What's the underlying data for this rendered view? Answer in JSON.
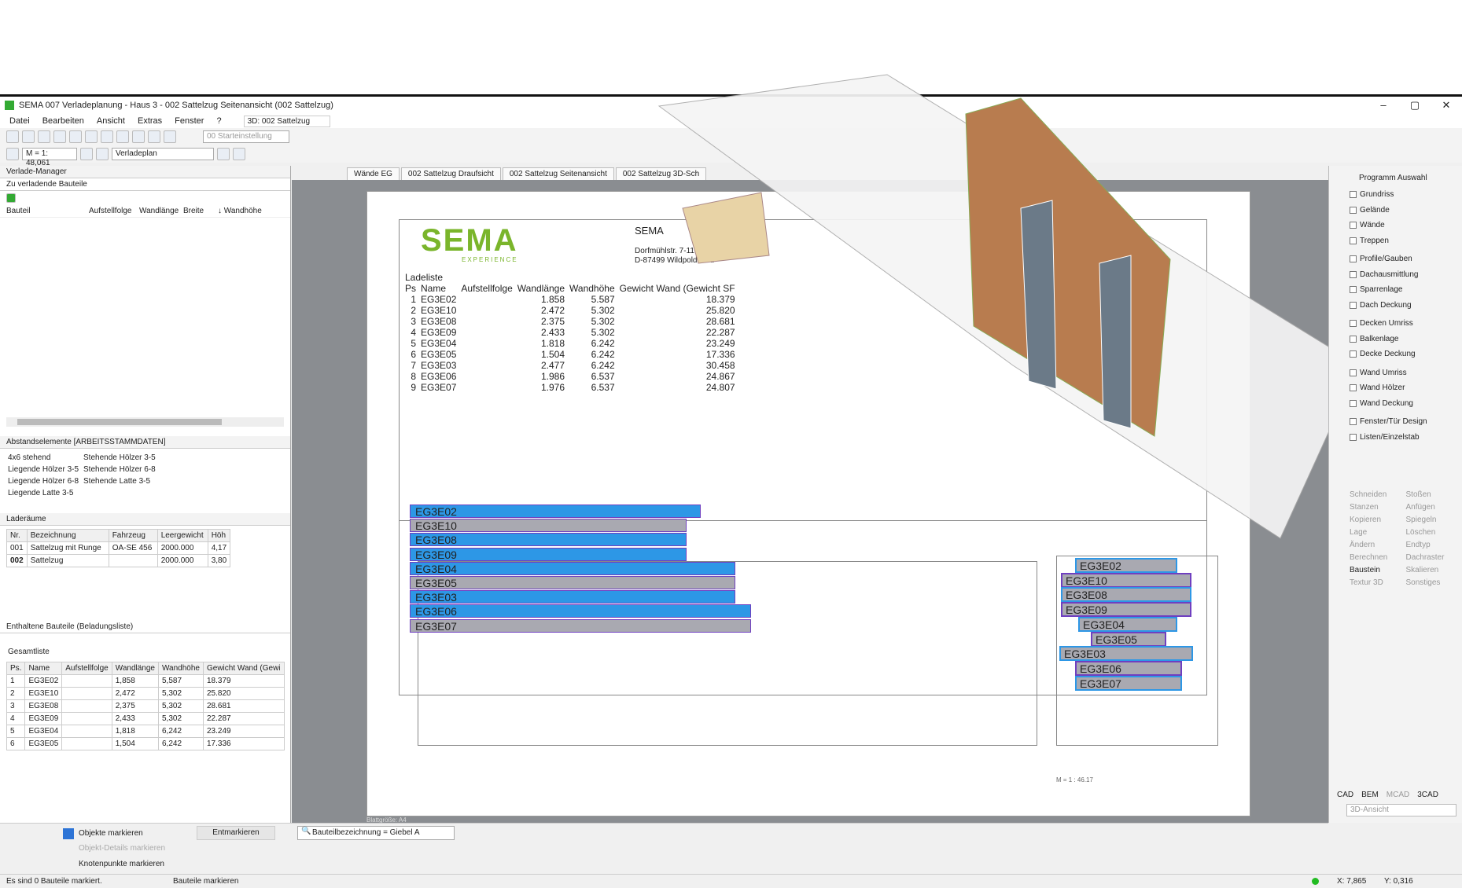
{
  "window": {
    "title": "SEMA  007 Verladeplanung - Haus 3  - 002 Sattelzug Seitenansicht (002 Sattelzug)",
    "min": "–",
    "max": "▢",
    "close": "✕"
  },
  "menu": [
    "Datei",
    "Bearbeiten",
    "Ansicht",
    "Extras",
    "Fenster",
    "?"
  ],
  "toolbar": {
    "view_select": "3D: 002 Sattelzug",
    "start_setting": "00 Starteinstellung",
    "scale": "M = 1: 48,061",
    "plan_select": "Verladeplan"
  },
  "left": {
    "manager_title": "Verlade-Manager",
    "to_load_title": "Zu verladende Bauteile",
    "to_load_cols": [
      "Bauteil",
      "Aufstellfolge",
      "Wandlänge",
      "Breite",
      "↓ Wandhöhe"
    ],
    "spacer_title": "Abstandselemente [ARBEITSSTAMMDATEN]",
    "spacer_items": [
      [
        "4x6 stehend",
        "Stehende Hölzer 3-5"
      ],
      [
        "Liegende Hölzer 3-5",
        "Stehende Hölzer 6-8"
      ],
      [
        "Liegende Hölzer 6-8",
        "Stehende Latte 3-5"
      ],
      [
        "Liegende Latte 3-5",
        ""
      ]
    ],
    "cargo_title": "Laderäume",
    "cargo_cols": [
      "Nr.",
      "Bezeichnung",
      "Fahrzeug",
      "Leergewicht",
      "Höh"
    ],
    "cargo_rows": [
      [
        "001",
        "Sattelzug mit Runge",
        "OA-SE 456",
        "2000.000",
        "4,17"
      ],
      [
        "002",
        "Sattelzug",
        "",
        "2000.000",
        "3,80"
      ]
    ],
    "contained_title": "Enthaltene Bauteile (Beladungsliste)",
    "total_label": "Gesamtliste",
    "contained_cols": [
      "Ps.",
      "Name",
      "Aufstellfolge",
      "Wandlänge",
      "Wandhöhe",
      "Gewicht Wand (Gewi"
    ],
    "contained_rows": [
      [
        "1",
        "EG3E02",
        "",
        "1,858",
        "5,587",
        "18.379"
      ],
      [
        "2",
        "EG3E10",
        "",
        "2,472",
        "5,302",
        "25.820"
      ],
      [
        "3",
        "EG3E08",
        "",
        "2,375",
        "5,302",
        "28.681"
      ],
      [
        "4",
        "EG3E09",
        "",
        "2,433",
        "5,302",
        "22.287"
      ],
      [
        "5",
        "EG3E04",
        "",
        "1,818",
        "6,242",
        "23.249"
      ],
      [
        "6",
        "EG3E05",
        "",
        "1,504",
        "6,242",
        "17.336"
      ]
    ]
  },
  "tabs": [
    "Wände EG",
    "002 Sattelzug Draufsicht",
    "002 Sattelzug Seitenansicht",
    "002 Sattelzug 3D-Sch"
  ],
  "sheet": {
    "logo": "SEMA",
    "logo_sub": "EXPERIENCE",
    "company": "SEMA",
    "street": "Dorfmühlstr. 7-11",
    "city": "D-87499 Wildpoldsried",
    "list_title": "Ladeliste",
    "list_cols": [
      "Ps",
      "Name",
      "Aufstellfolge",
      "Wandlänge",
      "Wandhöhe",
      "Gewicht Wand (Gewicht SF"
    ],
    "list_rows": [
      [
        "1",
        "EG3E02",
        "1.858",
        "5.587",
        "18.379"
      ],
      [
        "2",
        "EG3E10",
        "2.472",
        "5.302",
        "25.820"
      ],
      [
        "3",
        "EG3E08",
        "2.375",
        "5.302",
        "28.681"
      ],
      [
        "4",
        "EG3E09",
        "2.433",
        "5.302",
        "22.287"
      ],
      [
        "5",
        "EG3E04",
        "1.818",
        "6.242",
        "23.249"
      ],
      [
        "6",
        "EG3E05",
        "1.504",
        "6.242",
        "17.336"
      ],
      [
        "7",
        "EG3E03",
        "2.477",
        "6.242",
        "30.458"
      ],
      [
        "8",
        "EG3E06",
        "1.986",
        "6.537",
        "24.867"
      ],
      [
        "9",
        "EG3E07",
        "1.976",
        "6.537",
        "24.807"
      ]
    ],
    "bars": [
      "EG3E02",
      "EG3E10",
      "EG3E08",
      "EG3E09",
      "EG3E04",
      "EG3E05",
      "EG3E03",
      "EG3E06",
      "EG3E07"
    ],
    "stack": [
      "EG3E02",
      "EG3E10",
      "EG3E08",
      "EG3E09",
      "EG3E04",
      "EG3E05",
      "EG3E03",
      "EG3E06",
      "EG3E07"
    ],
    "scale_note": "M = 1 : 46.17",
    "sheet_size": "Blattgröße: A4"
  },
  "right": {
    "title": "Programm Auswahl",
    "items": [
      "Grundriss",
      "Gelände",
      "Wände",
      "Treppen",
      "Profile/Gauben",
      "Dachausmittlung",
      "Sparrenlage",
      "Dach Deckung",
      "Decken Umriss",
      "Balkenlage",
      "Decke Deckung",
      "Wand Umriss",
      "Wand Hölzer",
      "Wand Deckung",
      "Fenster/Tür Design",
      "Listen/Einzelstab"
    ],
    "tools": [
      "Schneiden",
      "Stoßen",
      "Stanzen",
      "Anfügen",
      "Kopieren",
      "Spiegeln",
      "Lage",
      "Löschen",
      "Ändern",
      "Endtyp",
      "Berechnen",
      "Dachraster",
      "Baustein",
      "Skalieren",
      "Textur 3D",
      "Sonstiges"
    ],
    "modes": [
      "CAD",
      "BEM",
      "MCAD",
      "3CAD"
    ],
    "view3d": "3D-Ansicht"
  },
  "bottom": {
    "mark_objects": "Objekte markieren",
    "unmark": "Entmarkieren",
    "mark_details": "Objekt-Details markieren",
    "mark_nodes": "Knotenpunkte markieren",
    "filter": "Bauteilbezeichnung = Giebel A"
  },
  "status": {
    "left": "Es sind 0 Bauteile markiert.",
    "mid": "Bauteile markieren",
    "x": "X: 7,865",
    "y": "Y: 0,316"
  }
}
